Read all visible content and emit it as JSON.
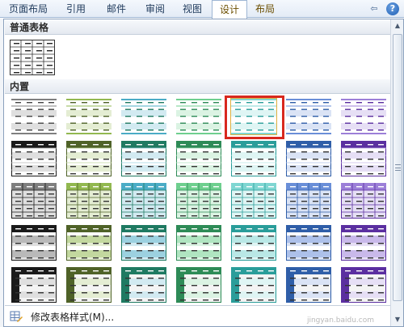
{
  "ribbon": {
    "tabs": [
      {
        "label": "页面布局",
        "active": false
      },
      {
        "label": "引用",
        "active": false
      },
      {
        "label": "邮件",
        "active": false
      },
      {
        "label": "审阅",
        "active": false
      },
      {
        "label": "视图",
        "active": false
      },
      {
        "label": "设计",
        "active": true
      },
      {
        "label": "布局",
        "active": false
      }
    ],
    "help_glyph": "?",
    "pin_glyph": "⇦"
  },
  "gallery": {
    "plain_header": "普通表格",
    "builtin_header": "内置",
    "selected_style": {
      "row": 1,
      "col": 5
    },
    "style_colors": [
      "#7f7f7f",
      "#92b850",
      "#4bacc6",
      "#6fcf8f",
      "#7fd6d2",
      "#6a8fd8",
      "#9c7fd8"
    ],
    "style_dark_colors": [
      "#1a1a1a",
      "#4f6228",
      "#1f7a62",
      "#2e8b57",
      "#2a9d9a",
      "#2f5ea8",
      "#5b2fa0"
    ]
  },
  "footer": {
    "modify_label": "修改表格样式(M)...",
    "watermark": "jingyan.baidu.com"
  }
}
